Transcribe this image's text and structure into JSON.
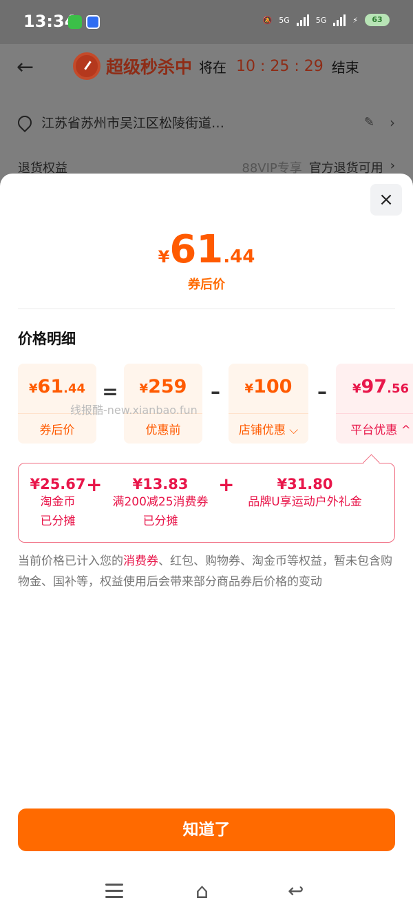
{
  "status_bar": {
    "time": "13:34",
    "net_a": "5G",
    "net_b": "5G",
    "battery": "63"
  },
  "header": {
    "seckill_title": "超级秒杀中",
    "will_label": "将在",
    "countdown": "10 : 25 : 29",
    "end_label": "结束"
  },
  "address": {
    "text": "江苏省苏州市吴江区松陵街道…"
  },
  "return_rights": {
    "label": "退货权益",
    "vip": "88VIP专享",
    "value": "官方退货可用"
  },
  "sheet": {
    "close_icon": "×",
    "hero": {
      "yen": "¥",
      "int": "61",
      "dec": ".44",
      "label": "券后价"
    },
    "section_title": "价格明细",
    "breakdown": [
      {
        "yen": "¥",
        "num": "61",
        "dec": ".44",
        "label": "券后价"
      },
      {
        "yen": "¥",
        "num": "259",
        "dec": "",
        "label": "优惠前"
      },
      {
        "yen": "¥",
        "num": "100",
        "dec": "",
        "label": "店铺优惠 ⌵"
      },
      {
        "yen": "¥",
        "num": "97",
        "dec": ".56",
        "label": "平台优惠 ^"
      }
    ],
    "operators": [
      "=",
      "–",
      "–"
    ],
    "watermark": "线报酷-new.xianbao.fun",
    "platform_items": [
      {
        "value": "¥25.67",
        "line1": "淘金币",
        "line2": "已分摊"
      },
      {
        "value": "¥13.83",
        "line1": "满200减25消费券",
        "line2": "已分摊"
      },
      {
        "value": "¥31.80",
        "line1": "品牌U享运动户外礼金",
        "line2": ""
      }
    ],
    "plus": "+",
    "note_pre": "当前价格已计入您的",
    "note_hl": "消费券",
    "note_post": "、红包、购物券、淘金币等权益，暂未包含购物金、国补等，权益使用后会带来部分商品券后价格的变动",
    "ok_button": "知道了"
  }
}
